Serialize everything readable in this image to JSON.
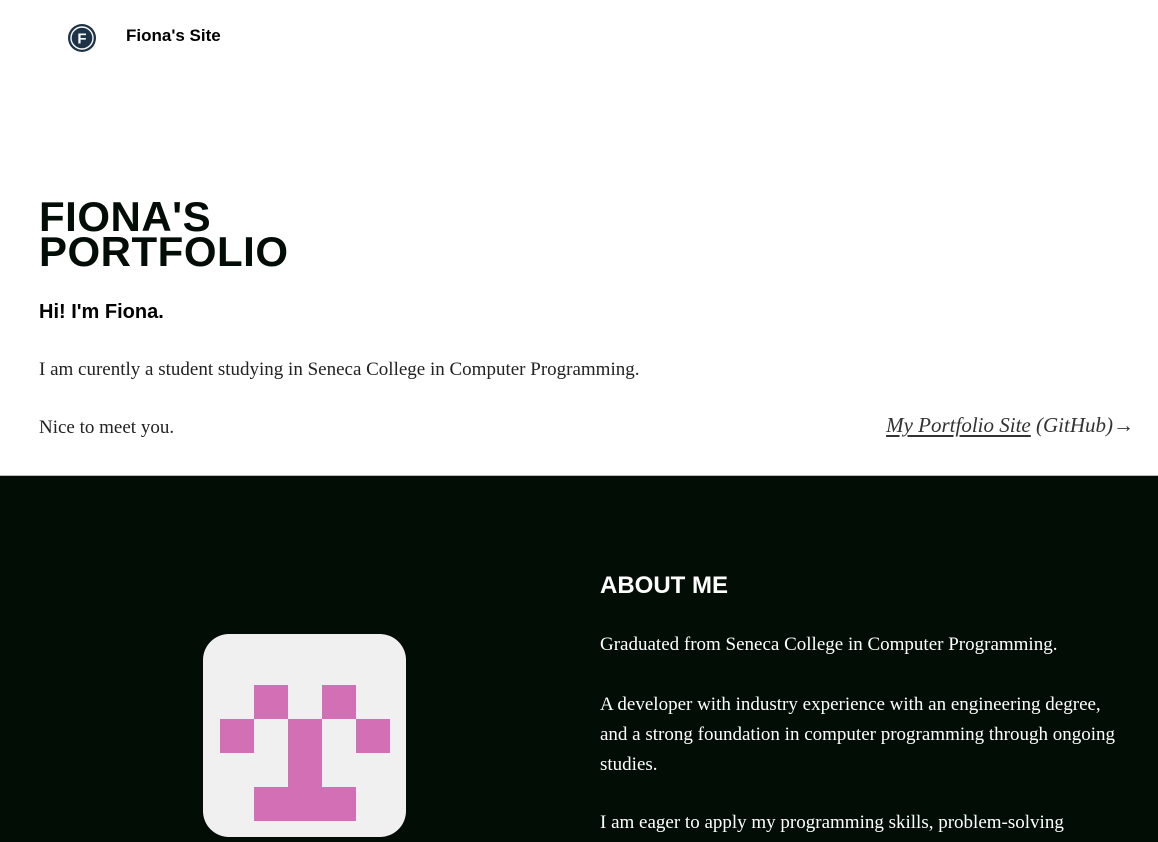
{
  "header": {
    "logo_letter": "F",
    "site_title": "Fiona's Site"
  },
  "hero": {
    "title_line1": "FIONA'S",
    "title_line2": "PORTFOLIO",
    "greeting": "Hi! I'm Fiona.",
    "intro": "I am curently a student studying in Seneca College in Computer Programming.",
    "meet": "Nice to meet you.",
    "portfolio_link": "My Portfolio Site",
    "portfolio_suffix": " (GitHub)→"
  },
  "about": {
    "heading": "ABOUT ME",
    "paragraphs": [
      "Graduated from Seneca College in Computer Programming.",
      "A developer with industry experience with an engineering degree, and a strong foundation in computer programming through ongoing studies.",
      "I am eager to apply my programming skills, problem-solving"
    ]
  },
  "colors": {
    "dark_bg": "#020d05",
    "avatar_bg": "#f0f0f0",
    "avatar_pixel": "#d36fb5"
  },
  "icons": {
    "logo": "letter-f-badge-icon",
    "avatar": "pixel-identicon"
  }
}
